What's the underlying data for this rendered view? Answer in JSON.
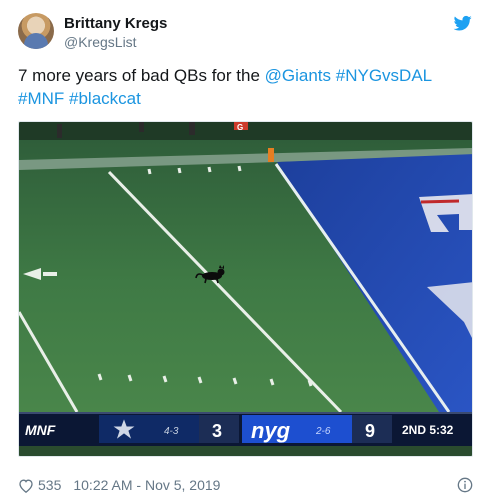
{
  "author": {
    "name": "Brittany Kregs",
    "handle": "@KregsList"
  },
  "tweet": {
    "text_plain": "7 more years of bad QBs for the ",
    "mention": "@Giants",
    "hashtags": [
      "#NYGvsDAL",
      "#MNF",
      "#blackcat"
    ]
  },
  "media": {
    "network": "MNF",
    "field_marker": "G",
    "away": {
      "record": "4-3",
      "score": "3"
    },
    "home": {
      "logo": "nyg",
      "record": "2-6",
      "score": "9"
    },
    "game_clock": "2ND 5:32"
  },
  "footer": {
    "likes": "535",
    "timestamp": "10:22 AM - Nov 5, 2019"
  },
  "icons": {
    "brand": "twitter-bird-icon",
    "like": "heart-icon",
    "info": "info-icon"
  },
  "colors": {
    "link": "#1b95e0",
    "twitter_blue": "#1da1f2",
    "muted": "#657786"
  }
}
